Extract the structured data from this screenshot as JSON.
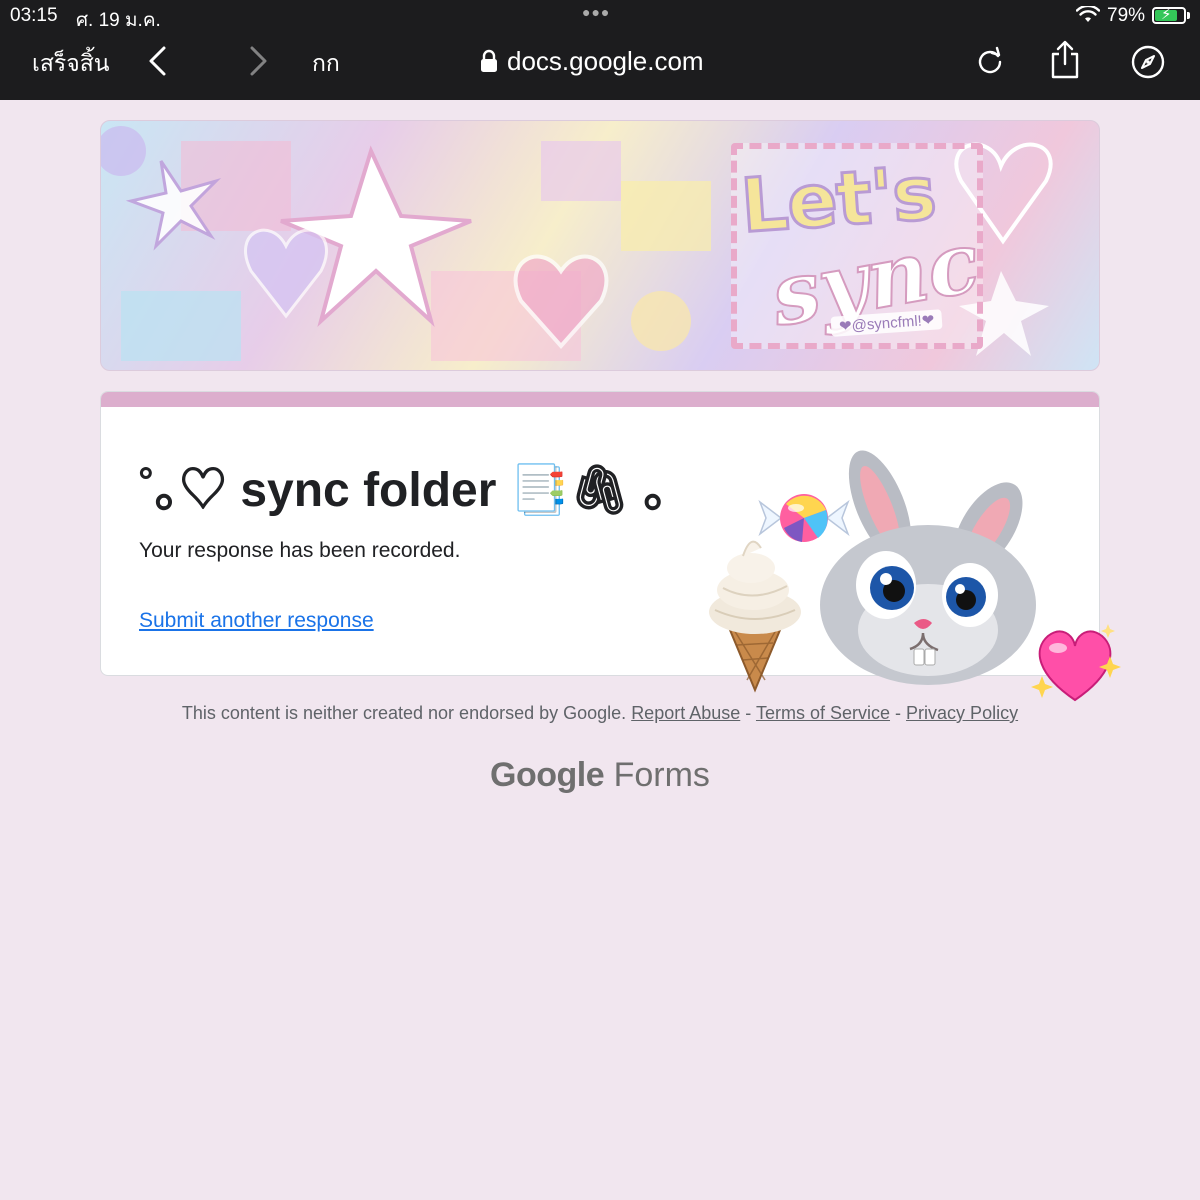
{
  "status_bar": {
    "time": "03:15",
    "date": "ศ. 19 ม.ค.",
    "battery_percent_label": "79%",
    "battery_level": 0.79,
    "battery_color": "#34c759"
  },
  "browser": {
    "done_label": "เสร็จสิ้น",
    "reader_label": "กก",
    "url": "docs.google.com",
    "icons": [
      "chevron-left-icon",
      "chevron-right-icon",
      "lock-icon",
      "reload-icon",
      "share-icon",
      "compass-icon"
    ]
  },
  "banner": {
    "title_line1": "Let's",
    "title_line2": "sync",
    "handle": "❤@syncfml!❤"
  },
  "form": {
    "title": "˚｡♡ sync folder 📑🖇 ｡",
    "confirmation": "Your response has been recorded.",
    "submit_another": "Submit another response",
    "accent_color": "#dcaecd",
    "link_color": "#1a73e8"
  },
  "stickers": [
    "candy",
    "ice-cream",
    "bunny",
    "sparkling-heart"
  ],
  "footer": {
    "disclaimer": "This content is neither created nor endorsed by Google.",
    "report_abuse": "Report Abuse",
    "sep": "-",
    "terms": "Terms of Service",
    "privacy": "Privacy Policy",
    "brand_google": "Google",
    "brand_forms": "Forms"
  },
  "colors": {
    "page_bg": "#f1e6ef",
    "chrome_bg": "#1c1c1e"
  }
}
